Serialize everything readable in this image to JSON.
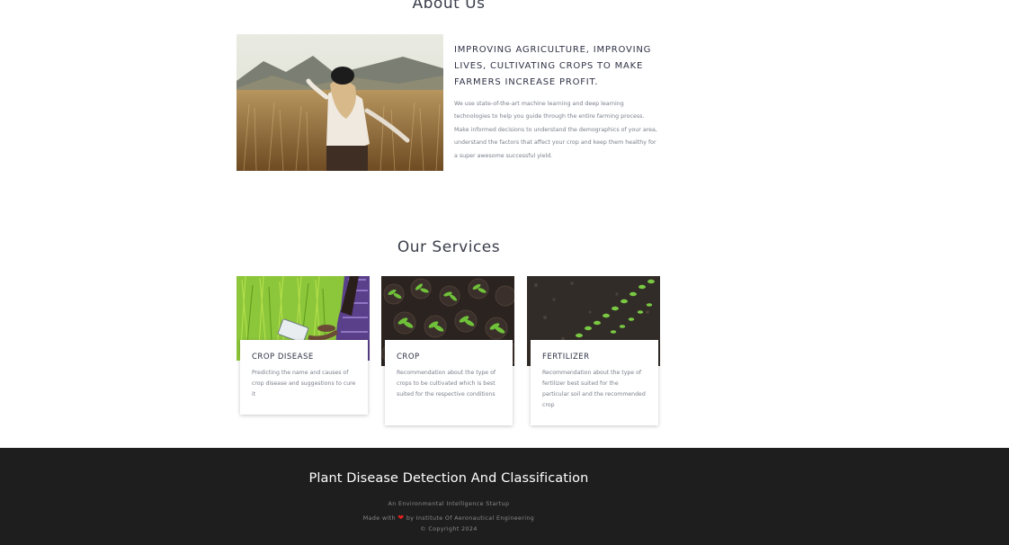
{
  "about": {
    "title": "About Us",
    "heading": "IMPROVING AGRICULTURE, IMPROVING LIVES, CULTIVATING CROPS TO MAKE FARMERS INCREASE PROFIT.",
    "body": "We use state-of-the-art machine learning and deep learning technologies to help you guide through the entire farming process. Make informed decisions to understand the demographics of your area, understand the factors that affect your crop and keep them healthy for a super awesome successful yield."
  },
  "services": {
    "title": "Our Services",
    "items": [
      {
        "title": "CROP DISEASE",
        "description": "Predicting the name and causes of crop disease and suggestions to cure it"
      },
      {
        "title": "CROP",
        "description": "Recommendation about the type of crops to be cultivated which is best suited for the respective conditions"
      },
      {
        "title": "FERTILIZER",
        "description": "Recommendation about the type of fertilizer best suited for the particular soil and the recommended crop"
      }
    ]
  },
  "footer": {
    "title": "Plant Disease Detection And Classification",
    "tagline": "An Environmental Intelligence Startup",
    "made_with": "Made with",
    "made_by": "by Institute Of Aeronautical Engineering",
    "copyright": "© Copyright 2024"
  },
  "icons": {
    "heart": "heart-icon"
  },
  "colors": {
    "footer_bg": "#1e1e1e",
    "heart": "#e02020",
    "heading_text": "#2f3245",
    "body_text": "#7a7f8a"
  }
}
